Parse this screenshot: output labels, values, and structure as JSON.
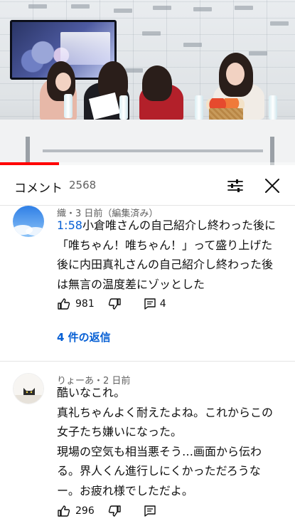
{
  "video": {
    "progress_fraction": 0.2
  },
  "comments_header": {
    "title": "コメント",
    "count": "2568",
    "filter_icon": "sliders-icon",
    "close_icon": "close-icon"
  },
  "comments": [
    {
      "author": "織・3 日前（編集済み）",
      "timestamp_link": "1:58",
      "text_after_timestamp": "小倉唯さんの自己紹介し終わった後に「唯ちゃん！唯ちゃん！」って盛り上げた後に内田真礼さんの自己紹介し終わった後は無言の温度差にゾッとした",
      "likes": "981",
      "reply_count": "4",
      "replies_link": "4 件の返信",
      "avatar": "blue-sky-avatar"
    },
    {
      "author": "りょーあ・2 日前",
      "lines": [
        "酷いなこれ。",
        "真礼ちゃんよく耐えたよね。これからこの女子たち嫌いになった。",
        "現場の空気も相当悪そう…画面から伝わる。界人くん進行しにくかっただろうなー。お疲れ様でしただよ。"
      ],
      "likes": "296",
      "avatar": "cat-avatar"
    }
  ],
  "colors": {
    "link": "#065fd4",
    "progress": "#ff0000",
    "secondary_text": "#606060"
  }
}
